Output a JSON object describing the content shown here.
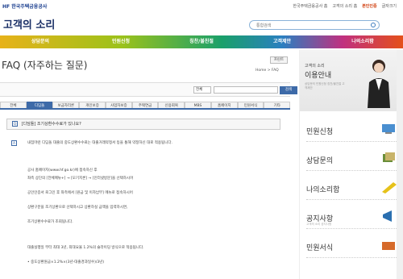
{
  "topbar": {
    "logo": "HF 한국주택금융공사",
    "links": [
      "한국주택금융공사 홈",
      "고객의 소리 홈",
      "본인인증",
      "글자크기"
    ]
  },
  "site": {
    "title": "고객의 소리",
    "search_placeholder": "통합검색"
  },
  "menu": [
    "상담문의",
    "민원신청",
    "칭찬/불친절",
    "고객제안",
    "나의소리함"
  ],
  "page": {
    "title": "FAQ (자주하는 질문)",
    "print_label": "프린트",
    "breadcrumb": "Home > FAQ",
    "select_value": "전체",
    "search_button": "검색"
  },
  "tabs": [
    "전체",
    "디딤돌",
    "보금자리론",
    "개인보증",
    "사업자보증",
    "주택연금",
    "신용회복",
    "MBS",
    "홈페이지",
    "민원서식",
    "기타"
  ],
  "question": {
    "icon": "Q",
    "text": "[디딤돌] 조기상환수수료가 있나요?"
  },
  "answer": {
    "icon": "A",
    "lines": [
      "내집마련 디딤돌 대출의 중도상환수수료는 대출거래약정서 등을 통해 약정하신 대로 적용됩니다.",
      "공사 홈페이지(www.hf.go.kr)에 접속하신 후",
      "좌측 상단의 [전체메뉴+] → [모기지론] → [인터넷방문]을 선택하시어",
      "공인인증서 로그인 후 좌측에서 [원금 및 이자납부] 메뉴로 접속하시어",
      "상환구분을 조기상환으로 선택하시고 상환하실 금액을 입력하시면,",
      "조기상환수수료가 조회됩니다.",
      "대출실행일 부터 최대 3년, 최대요율 1.2%의 슬라이딩 방식으로 적용됩니다.",
      "• 중도상환원금×1.2%×(3년-대출경과일수)/3년)"
    ]
  },
  "sidebar": {
    "banner_small": "고객의 소리",
    "banner_big": "이용안내",
    "banner_desc": "상담문의 민원신청 칭찬/불친절 고객제안",
    "items": [
      {
        "label": "민원신청",
        "sub": ""
      },
      {
        "label": "상담문의",
        "sub": ""
      },
      {
        "label": "나의소리함",
        "sub": ""
      },
      {
        "label": "공지사항",
        "sub": "고객의 소리 공지사항"
      },
      {
        "label": "민원서식",
        "sub": ""
      }
    ]
  }
}
